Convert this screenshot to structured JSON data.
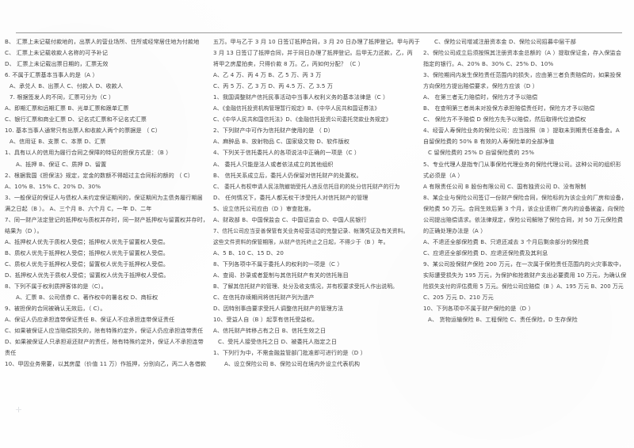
{
  "document": {
    "type": "scanned-exam-paper",
    "language": "zh-CN",
    "columns": 3,
    "rule_color": "#9a9a9a",
    "paper_color": "#fefefe",
    "ink_color": "#444444"
  },
  "column_left": {
    "lines": [
      {
        "text": "B、 汇票上未记载付款地的，出票人的营业场所、住所或经常居住地为付款地",
        "indent": 0
      },
      {
        "text": "C、 汇票上未记载收款人名称的可予补记",
        "indent": 0
      },
      {
        "text": "D、 汇票上未记载出票日期的，汇票无效",
        "indent": 0
      },
      {
        "text": "6. 不属于汇票基本当事人的是（A ）",
        "indent": 0
      },
      {
        "text": "A、承兑人 B、出票人 C、付款人 D、收款人",
        "indent": 1
      },
      {
        "text": "7. 根据签发人的不同，汇票可分为（C ）",
        "indent": 1
      },
      {
        "text": "A、即期汇票和远期汇票 B、光单汇票和跟单汇票",
        "indent": 0
      },
      {
        "text": "C、银行汇票和商业汇票 D、记名式汇票和不记名式汇票",
        "indent": 0
      },
      {
        "text": "10. 基本当事人通常只有出票人和收款人两个的票据是 （ C）",
        "indent": 0
      },
      {
        "text": "A、信用证 B、支票 C、本票 D、汇票",
        "indent": 1
      },
      {
        "text": "1、具有以人的信用为履行合同之保障的特征的担保方式是：（B ）",
        "indent": 0
      },
      {
        "text": "A、抵押     B、保证     C、质押     D、留置",
        "indent": 2
      },
      {
        "text": "2、根据我国《担保法》规定，定金的数额不得超过主合同标的额的 （ C）",
        "indent": 0
      },
      {
        "text": "A、10%    B、15%    C、20%    D、30%",
        "indent": 0
      },
      {
        "text": "3、一般保证的保证人与债权人未约定保证期间的，保证期间为主债务履行期届",
        "indent": 0
      },
      {
        "text": "满之日起（B ）。  A、三个月 B、六个月 C，一年 D、二年",
        "indent": 0
      },
      {
        "text": "7、同一财产法定登记的抵押权与质权并存时，同一财产抵押权与留置权并存时，",
        "indent": 0
      },
      {
        "text": "结果为（D ）。",
        "indent": 0
      },
      {
        "text": "A、抵押权人优先于质权人受偿；抵押权人优先于留置权人受偿。",
        "indent": 0
      },
      {
        "text": "B、质权人优先于抵押权人受偿；抵押权人优先于留置权人受偿。",
        "indent": 0
      },
      {
        "text": "C、质权人优先于抵押权人受偿；留置权人优先于抵押权人受偿。",
        "indent": 0
      },
      {
        "text": "D、抵押权人优先于质权人受偿；留置权人优先于抵押权人受偿。",
        "indent": 0
      },
      {
        "text": "8、下列不属于权利质押客体的是（C）。",
        "indent": 0
      },
      {
        "text": "A、汇票   B、公司债券    C、著作权中的署名权   D、商标权",
        "indent": 2
      },
      {
        "text": "9、被担保的合同被确认无效后，（ C）。",
        "indent": 0
      },
      {
        "text": "A、保证人仍应承担连带保证责任 B、保证人不应承担连带保证责任",
        "indent": 0
      },
      {
        "text": "C、如果被保证人应当赔偿损失的，除有特殊约定外，保证人仍应承担连带责任",
        "indent": 0
      },
      {
        "text": "D、如果被保证人只承担返还财产的责任，除有特殊约定外，保证人不承担连带",
        "indent": 0
      },
      {
        "text": "责任",
        "indent": 0
      },
      {
        "text": "10、甲因业务需要，以其房屋（价值 11 万）作抵押，分别向乙，丙二人各借款",
        "indent": 0
      }
    ]
  },
  "column_middle": {
    "lines": [
      {
        "text": "五万。甲与乙于 3 月 10 日签订抵押合同，3 月 20 日办理了抵押登记。甲与丙于",
        "indent": 0
      },
      {
        "text": "3 月 13 日签订了抵押合同，并于同日办理了抵押登记。后甲无力还款，乙，丙",
        "indent": 0
      },
      {
        "text": "将甲之房屋拍卖，只得价款 8 万。乙，丙如何分配？（C ）",
        "indent": 0
      },
      {
        "text": "A、乙 4 万、丙 4 万      B、乙 5 万、丙 3 万",
        "indent": 0
      },
      {
        "text": "C、丙 5 万、乙 3 万      D、丙 4.5 万、乙 3.5 万",
        "indent": 0
      },
      {
        "text": "1、我国调整财产信托民事活动中当事人权利义务的基本法律是（C ）",
        "indent": 0
      },
      {
        "text": "A、《金融信托投资机构管理暂行规定》B、《中华人民共和国证券法》",
        "indent": 0
      },
      {
        "text": "C、《中华人民共和国信托法》D、《金融信托投资公司委托贷款业务规定》",
        "indent": 0
      },
      {
        "text": "2、下列财产中可作为信托财产使用的是 （ D）",
        "indent": 0
      },
      {
        "text": "A、麻醉品 B、放射物品  C、国家级文物    D、软件版权",
        "indent": 0
      },
      {
        "text": "4、下列关于信托委托人的各项说法中正确的一项是（C ）",
        "indent": 0
      },
      {
        "text": "A、  委托人只能是法人或者依法成立的其他组织",
        "indent": 0
      },
      {
        "text": "B、  信托关系成立后，委托人仍保留对信托财产的处置权。",
        "indent": 0
      },
      {
        "text": "C、  委托人有权申请人民法院撤销受托人违反信托目的的处分信托财产的行为",
        "indent": 0
      },
      {
        "text": "D、  任何情况下，委托人都无权干涉受托人对信托财产的管理",
        "indent": 0
      },
      {
        "text": "5、设立信托公司应由（D ）审查批准。",
        "indent": 0
      },
      {
        "text": "A、财政部 B、中国保监会 C、中国证监会 D、中国人民银行",
        "indent": 0
      },
      {
        "text": "7、信托公司应当妥善保管有关业务经营活动的完整记录、帐簿凭证及有关资料。",
        "indent": 0
      },
      {
        "text": "这些文件资料的保管期限，从财产信托终止之日起，不得少于（B ）年。",
        "indent": 0
      },
      {
        "text": "A、5    B、10    C、15   D、20",
        "indent": 0
      },
      {
        "text": "8、下列各项中不属于委托人的权利的一项是（C ）",
        "indent": 0
      },
      {
        "text": "A、查阅、抄录或者复制与其信托财产有关的信托账目",
        "indent": 0
      },
      {
        "text": "B、了解其信托财产的管理、处分及收支情况，并有权要求受托人作出说明。",
        "indent": 0
      },
      {
        "text": "C、在信托存续期间将信托财产列为遗产",
        "indent": 0
      },
      {
        "text": "D、因特别事由要求受托人调整信托财产的管理方法",
        "indent": 0
      },
      {
        "text": "10、受益人自（B ）起享有信托受益权。",
        "indent": 0
      },
      {
        "text": "A、信托财产转移占有之日     B、信托生效之日",
        "indent": 0
      },
      {
        "text": "C、受托人接受信托之日   D、被委托人指定之日",
        "indent": 1
      },
      {
        "text": "1、下列行为中，不需金融监管部门批准即可进行的是（D ）",
        "indent": 0
      },
      {
        "text": "A、设立保险公司 B、保险公司在境内外设立代表机构",
        "indent": 2
      }
    ]
  },
  "column_right": {
    "lines": [
      {
        "text": "C、保险公司增减注册资本金   D、保险公司招募中层干部",
        "indent": 2
      },
      {
        "text": "2、保险公司成立后须按照其注册资本金总额的（A ）提取保证金，存入保监会",
        "indent": 0
      },
      {
        "text": "指定的银行。A、20% B、30% C、25% D、10%",
        "indent": 0
      },
      {
        "text": "3、保险期间内发生保险责任范围内的损失，应由第三者负责赔偿的，如果投保",
        "indent": 0
      },
      {
        "text": "方向保险方提出赔偿要求，保险方应该（D ）",
        "indent": 0
      },
      {
        "text": "A、  在第三者无力赔偿时，保险方才予以赔偿",
        "indent": 0
      },
      {
        "text": "B、  在查明第三者尚未对投保方承担赔偿责任时，保险方才予以赔偿",
        "indent": 0
      },
      {
        "text": "C、  保险方不予赔偿 D 保险方先予以赔偿，然后取得代位追偿权",
        "indent": 0
      },
      {
        "text": "4、经营人寿保险业务的保险公司：应当按照（B ）提取未到期责任准备金。A",
        "indent": 0
      },
      {
        "text": "自留保险费的 50% B 有效的人寿保险单的全部净值",
        "indent": 0
      },
      {
        "text": "C 留保险费的 25%  D 自留保险费的 25%",
        "indent": 1
      },
      {
        "text": "5、专业代理人是指专门从事保险代理业务的保险代理公司。这种公司的组织形",
        "indent": 0
      },
      {
        "text": "式必须是（A ）",
        "indent": 0
      },
      {
        "text": "A 有限责任公司   B 股份有限公司 C、国有独资公司 D、没有限制",
        "indent": 0
      },
      {
        "text": "8、某企业与保险公司签订一份财产保险合同，保险标的为该企业的厂房和设备，",
        "indent": 0
      },
      {
        "text": "保险费 50 万元。合同生效后第 3 个月，该企业谎称厂房内的设备被盗，向保险",
        "indent": 0
      },
      {
        "text": "公司提出赔偿请求。依法律规定，保险公司解除了保险合同，对 50 万元保险费",
        "indent": 0
      },
      {
        "text": "的正确处理办法是（A ）",
        "indent": 0
      },
      {
        "text": "A、不退还全部保险费 B、只退还减去 3 个月后剩余部分的保险费",
        "indent": 0
      },
      {
        "text": "C、应退还全部保险费   D、应退还保险费及其利息",
        "indent": 0
      },
      {
        "text": "9、某公司投保财产保险 200 万元，在一次属于保险责任范围内的火灾事故中，",
        "indent": 0
      },
      {
        "text": "实际遭受损失为 195 万元，为保护和抢救财产支出必要费用 10 万元，为确认保",
        "indent": 0
      },
      {
        "text": "险损失支付的评估费用 5 万元。保险公司应赔偿（B ）A、195 万元 B、200 万元",
        "indent": 0
      },
      {
        "text": "C、205 万元 D、210 万元",
        "indent": 0
      },
      {
        "text": "10、下列各项中不属于财产保险的是（D ）",
        "indent": 0
      },
      {
        "text": "A、  货物运输保险 B、工程保险 C、责任保险，D 生存保险",
        "indent": 1
      }
    ]
  }
}
